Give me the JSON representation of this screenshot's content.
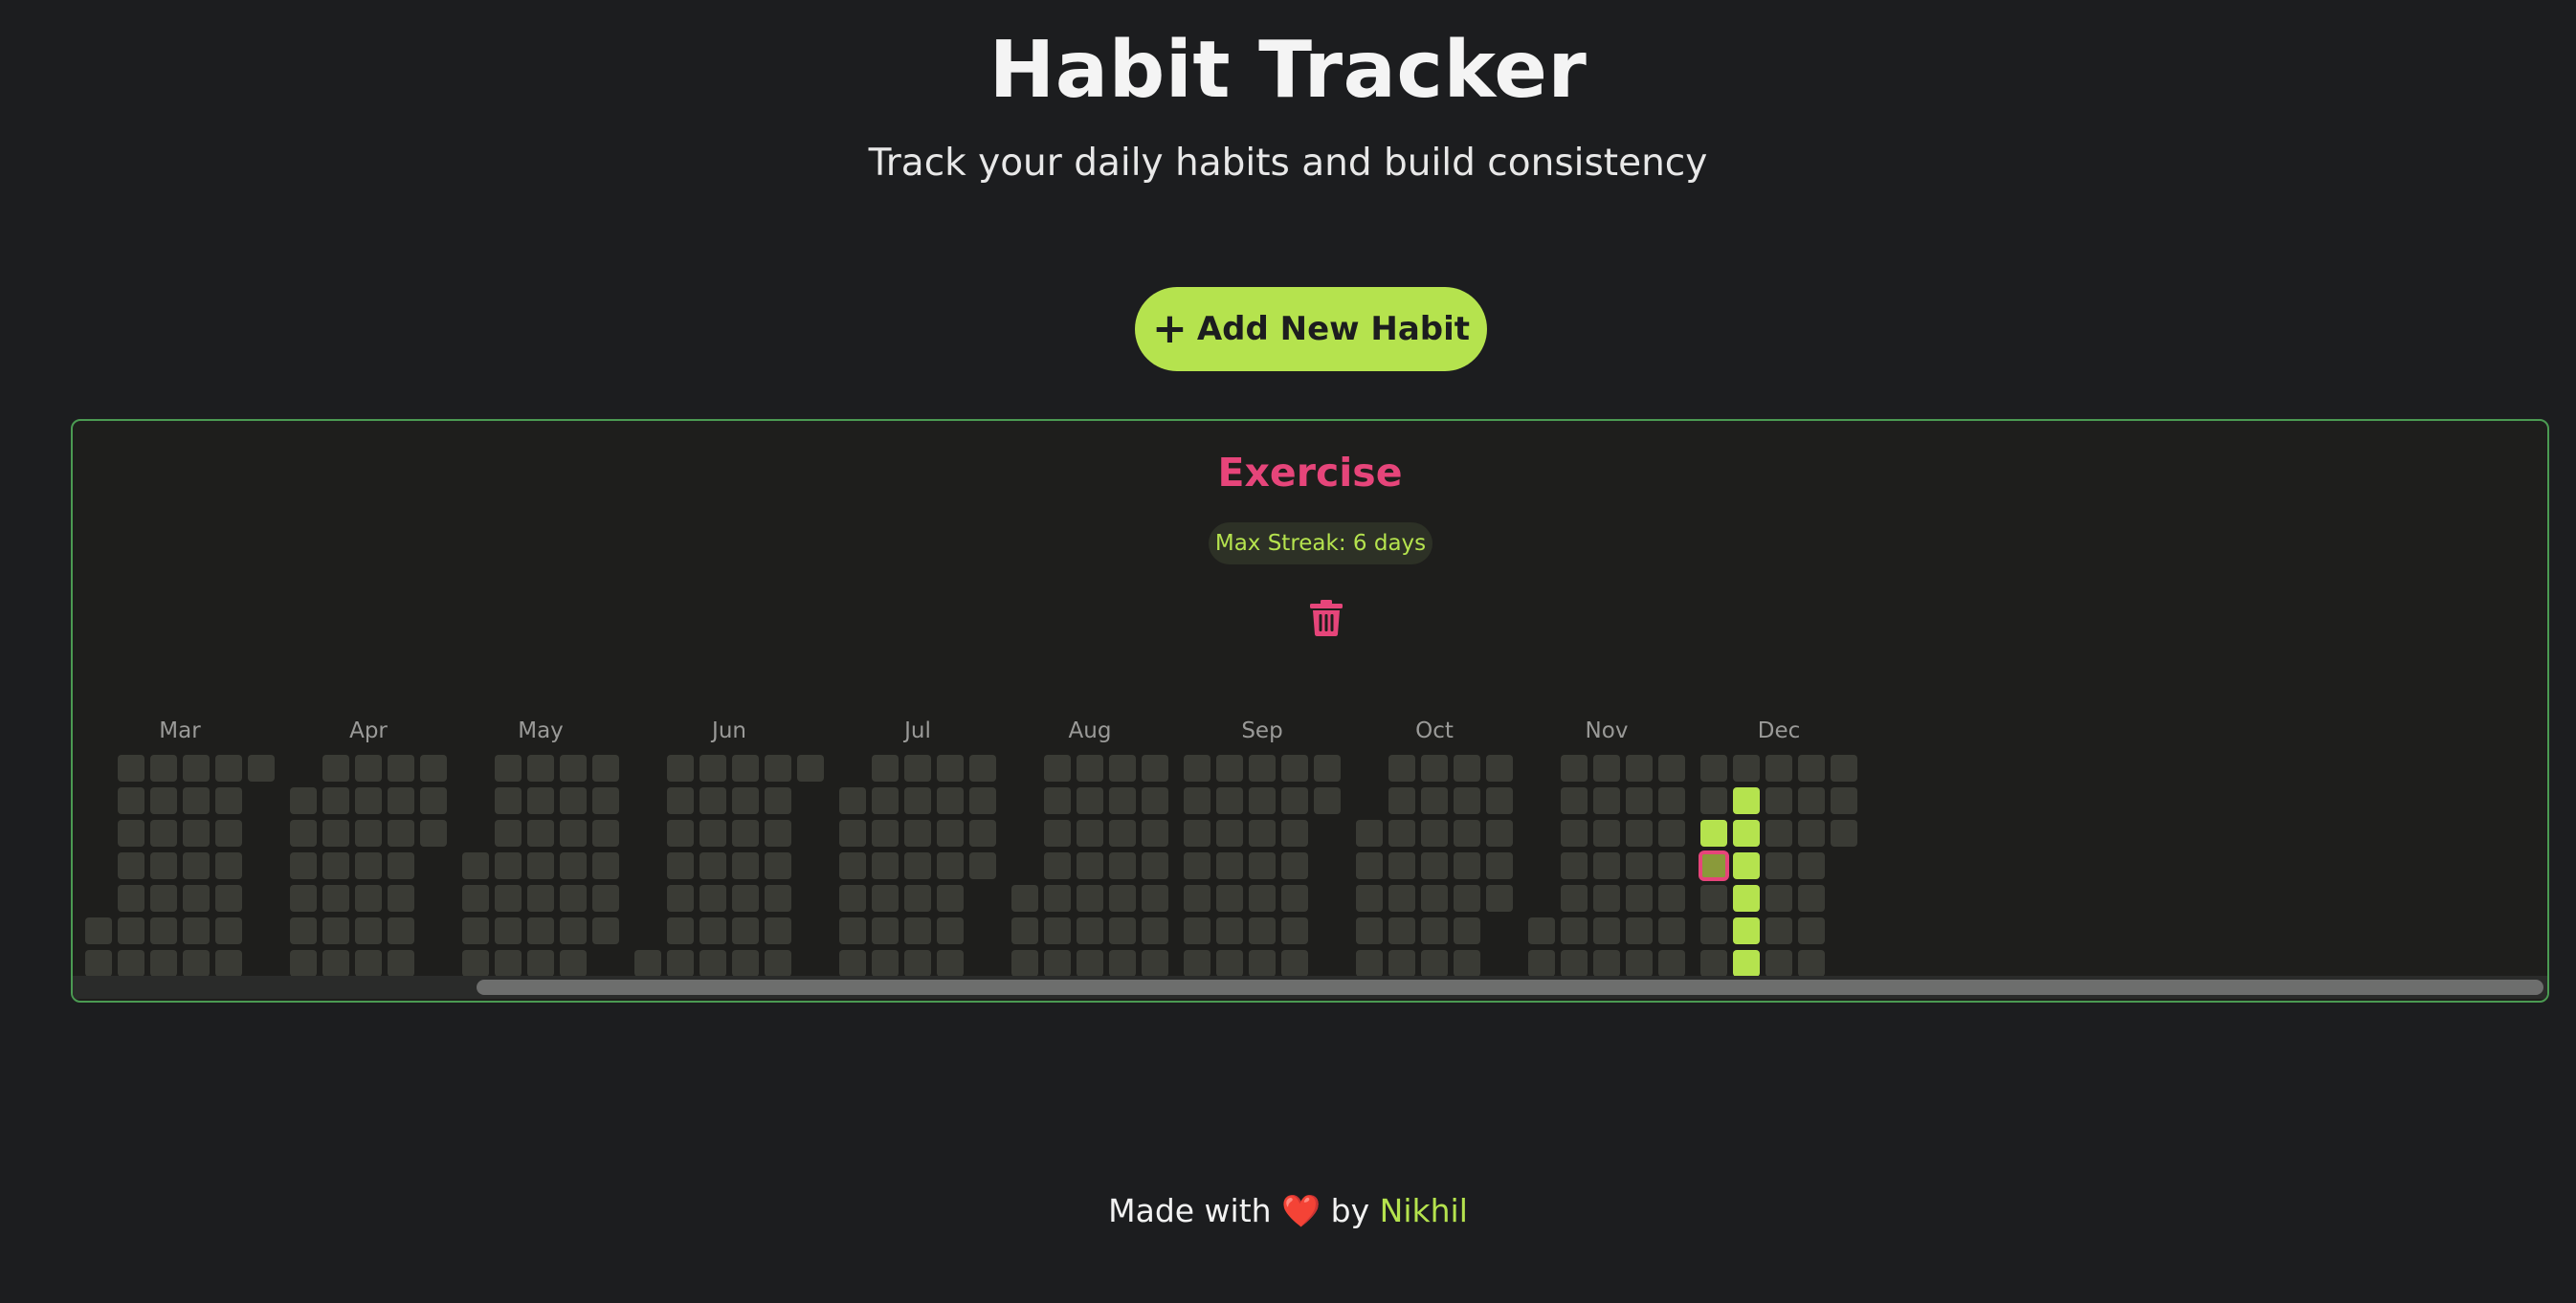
{
  "header": {
    "title": "Habit Tracker",
    "subtitle": "Track your daily habits and build consistency"
  },
  "add_button": {
    "icon": "plus-icon",
    "label": "Add New Habit"
  },
  "habit": {
    "name": "Exercise",
    "streak_label": "Max Streak: 6 days",
    "delete_icon": "trash-icon",
    "months": [
      "Mar",
      "Apr",
      "May",
      "Jun",
      "Jul",
      "Aug",
      "Sep",
      "Oct",
      "Nov",
      "Dec"
    ],
    "completed_days": [
      "Dec 3",
      "Dec 9",
      "Dec 10",
      "Dec 11",
      "Dec 12",
      "Dec 13",
      "Dec 14"
    ],
    "today": "Dec 4"
  },
  "footer": {
    "made_with": "Made with",
    "heart": "❤️",
    "by": "by",
    "author": "Nikhil"
  },
  "colors": {
    "background": "#1c1d1f",
    "accent_green": "#b5e34e",
    "accent_pink": "#e6457a",
    "cell_empty": "#3a3b35",
    "card_border": "#4b9a52"
  }
}
